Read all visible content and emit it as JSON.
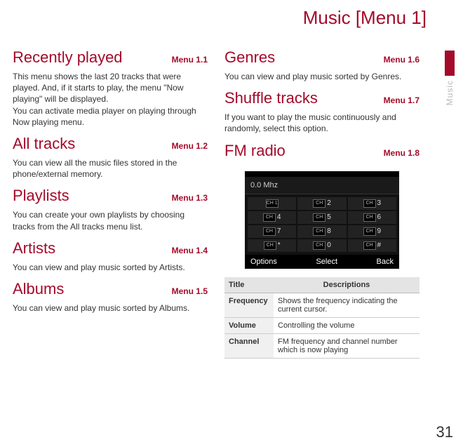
{
  "page_title": "Music [Menu 1]",
  "side_label": "Music",
  "page_number": "31",
  "sections_left": [
    {
      "title": "Recently played",
      "ref": "Menu 1.1",
      "body": "This menu shows the last 20 tracks that were played. And, if it starts to play, the menu \"Now playing\" will be displayed.\nYou can activate media player on playing through Now playing menu."
    },
    {
      "title": "All tracks",
      "ref": "Menu 1.2",
      "body": "You can view all the music files stored in the phone/external memory."
    },
    {
      "title": "Playlists",
      "ref": "Menu 1.3",
      "body": "You can create your own playlists by choosing tracks from the All tracks menu list."
    },
    {
      "title": "Artists",
      "ref": "Menu 1.4",
      "body": "You can view and play music sorted by Artists."
    },
    {
      "title": "Albums",
      "ref": "Menu 1.5",
      "body": "You can view and play music sorted by Albums."
    }
  ],
  "sections_right": [
    {
      "title": "Genres",
      "ref": "Menu 1.6",
      "body": "You can view and play music sorted by Genres."
    },
    {
      "title": "Shuffle tracks",
      "ref": "Menu 1.7",
      "body": "If you want to play the music continuously and randomly, select this option."
    },
    {
      "title": "FM radio",
      "ref": "Menu 1.8",
      "body": ""
    }
  ],
  "fm": {
    "freq": "0.0 Mhz",
    "cells": [
      "CH 1",
      "2",
      "3",
      "4",
      "5",
      "6",
      "7",
      "8",
      "9",
      "*",
      "0",
      "#"
    ],
    "soft_left": "Options",
    "soft_center": "Select",
    "soft_right": "Back"
  },
  "table": {
    "head_title": "Title",
    "head_desc": "Descriptions",
    "rows": [
      {
        "title": "Frequency",
        "desc": "Shows the frequency indicating the current cursor."
      },
      {
        "title": "Volume",
        "desc": "Controlling the volume"
      },
      {
        "title": "Channel",
        "desc": "FM frequency and channel number which is now playing"
      }
    ]
  }
}
